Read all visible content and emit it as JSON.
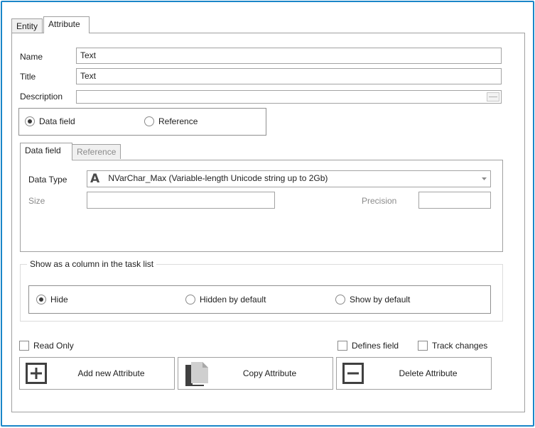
{
  "tabs": {
    "entity": "Entity",
    "attribute": "Attribute"
  },
  "form": {
    "name_label": "Name",
    "name_value": "Text",
    "title_label": "Title",
    "title_value": "Text",
    "description_label": "Description",
    "description_value": ""
  },
  "field_kind": {
    "data_field": "Data field",
    "reference": "Reference",
    "selected": "data_field"
  },
  "inner_tabs": {
    "data_field": "Data field",
    "reference": "Reference"
  },
  "data_field": {
    "data_type_label": "Data Type",
    "data_type_icon_glyph": "A",
    "data_type_value": "NVarChar_Max (Variable-length Unicode string up to 2Gb)",
    "size_label": "Size",
    "size_value": "",
    "precision_label": "Precision",
    "precision_value": ""
  },
  "task_list": {
    "title": "Show as a column in the task list",
    "hide": "Hide",
    "hidden_by_default": "Hidden by default",
    "show_by_default": "Show by default",
    "selected": "hide"
  },
  "options": {
    "read_only": "Read Only",
    "defines_field": "Defines field",
    "track_changes": "Track changes"
  },
  "buttons": {
    "add": "Add new Attribute",
    "copy": "Copy Attribute",
    "delete": "Delete Attribute"
  },
  "colors": {
    "frame": "#1a86c8",
    "border": "#a0a0a0",
    "icon": "#404040"
  }
}
